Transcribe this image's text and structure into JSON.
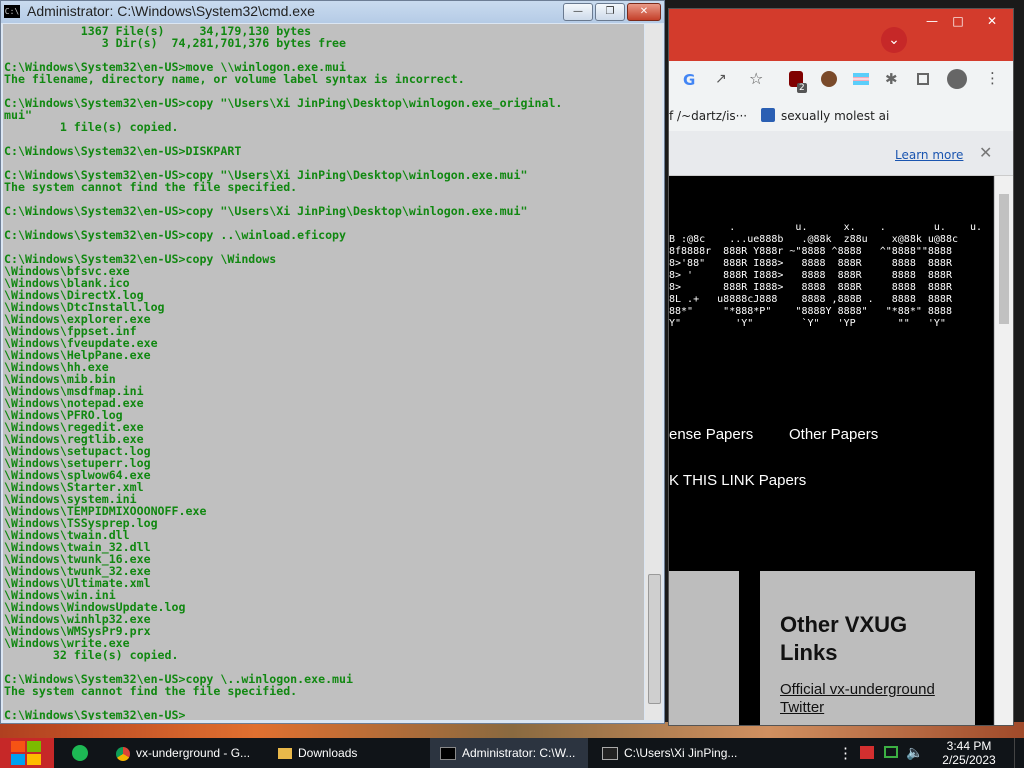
{
  "cmd": {
    "title": "Administrator: C:\\Windows\\System32\\cmd.exe",
    "icon_label": "C:\\",
    "lines": [
      "           1367 File(s)     34,179,130 bytes",
      "              3 Dir(s)  74,281,701,376 bytes free",
      "",
      "C:\\Windows\\System32\\en-US>move \\\\winlogon.exe.mui",
      "The filename, directory name, or volume label syntax is incorrect.",
      "",
      "C:\\Windows\\System32\\en-US>copy \"\\Users\\Xi JinPing\\Desktop\\winlogon.exe_original.",
      "mui\"",
      "        1 file(s) copied.",
      "",
      "C:\\Windows\\System32\\en-US>DISKPART",
      "",
      "C:\\Windows\\System32\\en-US>copy \"\\Users\\Xi JinPing\\Desktop\\winlogon.exe.mui\"",
      "The system cannot find the file specified.",
      "",
      "C:\\Windows\\System32\\en-US>copy \"\\Users\\Xi JinPing\\Desktop\\winlogon.exe.mui\"",
      "",
      "C:\\Windows\\System32\\en-US>copy ..\\winload.eficopy",
      "",
      "C:\\Windows\\System32\\en-US>copy \\Windows",
      "\\Windows\\bfsvc.exe",
      "\\Windows\\blank.ico",
      "\\Windows\\DirectX.log",
      "\\Windows\\DtcInstall.log",
      "\\Windows\\explorer.exe",
      "\\Windows\\fppset.inf",
      "\\Windows\\fveupdate.exe",
      "\\Windows\\HelpPane.exe",
      "\\Windows\\hh.exe",
      "\\Windows\\mib.bin",
      "\\Windows\\msdfmap.ini",
      "\\Windows\\notepad.exe",
      "\\Windows\\PFRO.log",
      "\\Windows\\regedit.exe",
      "\\Windows\\regtlib.exe",
      "\\Windows\\setupact.log",
      "\\Windows\\setuperr.log",
      "\\Windows\\splwow64.exe",
      "\\Windows\\Starter.xml",
      "\\Windows\\system.ini",
      "\\Windows\\TEMPIDMIXOOONOFF.exe",
      "\\Windows\\TSSysprep.log",
      "\\Windows\\twain.dll",
      "\\Windows\\twain_32.dll",
      "\\Windows\\twunk_16.exe",
      "\\Windows\\twunk_32.exe",
      "\\Windows\\Ultimate.xml",
      "\\Windows\\win.ini",
      "\\Windows\\WindowsUpdate.log",
      "\\Windows\\winhlp32.exe",
      "\\Windows\\WMSysPr9.prx",
      "\\Windows\\write.exe",
      "       32 file(s) copied.",
      "",
      "C:\\Windows\\System32\\en-US>copy \\..winlogon.exe.mui",
      "The system cannot find the file specified.",
      "",
      "C:\\Windows\\System32\\en-US>"
    ]
  },
  "chrome": {
    "bookmarks": [
      "f /~dartz/is···",
      "sexually molest ai"
    ],
    "extension_badge": "2",
    "infobar_link": "Learn more",
    "ascii_art": "          .          u.      x.    .        u.    u.\nB :@8c    ...ue888b   .@88k  z88u    x@88k u@88c\n8f8888r  888R Y888r ~\"8888 ^8888   ^\"8888\"\"8888\n8>'88\"   888R I888>   8888  888R     8888  888R\n8> '     888R I888>   8888  888R     8888  888R\n8>       888R I888>   8888  888R     8888  888R\n8L .+   u8888cJ888    8888 ,888B .   8888  888R\n88*\"     \"*888*P\"    \"8888Y 8888\"   \"*88*\" 8888\nY\"         'Y\"        `Y\"   'YP       \"\"   'Y\"",
    "nav": [
      "ense Papers",
      "Other Papers"
    ],
    "nav2": "K THIS LINK Papers",
    "card_title": "Other VXUG Links",
    "card_links": [
      "Official vx-underground",
      "Twitter"
    ]
  },
  "taskbar": {
    "items": [
      "vx-underground - G...",
      "Downloads",
      "Administrator: C:\\W...",
      "C:\\Users\\Xi JinPing..."
    ],
    "time": "3:44 PM",
    "date": "2/25/2023"
  }
}
